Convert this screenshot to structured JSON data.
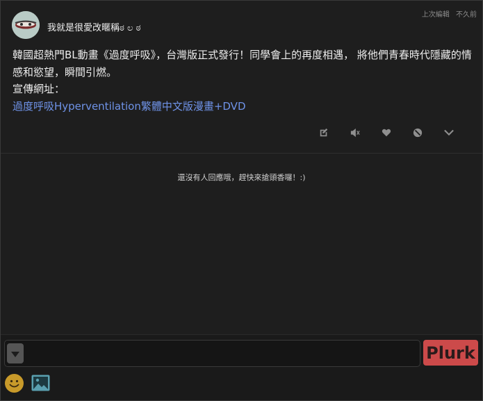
{
  "post": {
    "author": "我就是很愛改暱稱ಠ ಲ ಠ",
    "meta_edit": "上次編輯",
    "meta_time": "不久前",
    "content_line1": "韓國超熱門BL動畫《過度呼吸》，台灣版正式發行！同學會上的再度相遇， 將他們青春時代隱藏的情感和慾望，瞬間引燃。",
    "content_line2": "宣傳網址：",
    "link_text": "過度呼吸Hyperventilation繁體中文版漫畫+DVD"
  },
  "actions": {
    "icons": [
      "edit-icon",
      "mute-icon",
      "heart-icon",
      "block-icon",
      "chevron-down-icon"
    ]
  },
  "responses": {
    "empty_message": "還沒有人回應哦，趕快來搶頭香囉！:)"
  },
  "composer": {
    "input_value": "",
    "submit_label": "Plurk"
  },
  "colors": {
    "background": "#1e1e1e",
    "link": "#6f93e8",
    "plurk_button": "#cc4a4a",
    "icon": "#8f8f8f"
  }
}
